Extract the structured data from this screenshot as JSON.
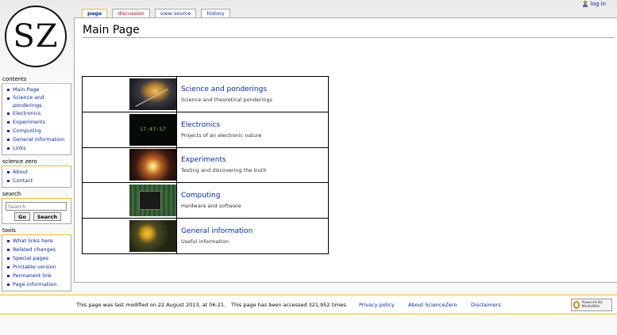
{
  "logo": {
    "text": "SZ"
  },
  "personal": {
    "login": "log in",
    "user_icon": "user-icon"
  },
  "tabs": [
    {
      "label": "page"
    },
    {
      "label": "discussion"
    },
    {
      "label": "view source"
    },
    {
      "label": "history"
    }
  ],
  "page": {
    "title": "Main Page"
  },
  "portal": [
    {
      "title": "Science and ponderings",
      "desc": "Science and theoretical ponderings"
    },
    {
      "title": "Electronics",
      "desc": "Projects of an electronic nature",
      "clock": "17:47:57"
    },
    {
      "title": "Experiments",
      "desc": "Testing and discovering the truth"
    },
    {
      "title": "Computing",
      "desc": "Hardware and software"
    },
    {
      "title": "General information",
      "desc": "Useful information"
    }
  ],
  "sidebar": {
    "contents": {
      "heading": "contents",
      "items": [
        "Main Page",
        "Science and ponderings",
        "Electronics",
        "Experiments",
        "Computing",
        "General information",
        "Links"
      ]
    },
    "sciencezero": {
      "heading": "science zero",
      "items": [
        "About",
        "Contact"
      ]
    },
    "search": {
      "heading": "search",
      "placeholder": "Search",
      "go": "Go",
      "search": "Search"
    },
    "tools": {
      "heading": "tools",
      "items": [
        "What links here",
        "Related changes",
        "Special pages",
        "Printable version",
        "Permanent link",
        "Page information"
      ]
    }
  },
  "footer": {
    "lastmod": "This page was last modified on 22 August 2013, at 06:21.",
    "views": "This page has been accessed 321,952 times.",
    "privacy": "Privacy policy",
    "about": "About ScienceZero",
    "disclaimers": "Disclaimers",
    "poweredby": "Powered By MediaWiki"
  },
  "colors": {
    "link": "#002bb8",
    "accent": "#fabd23",
    "new_link": "#ba0000"
  }
}
